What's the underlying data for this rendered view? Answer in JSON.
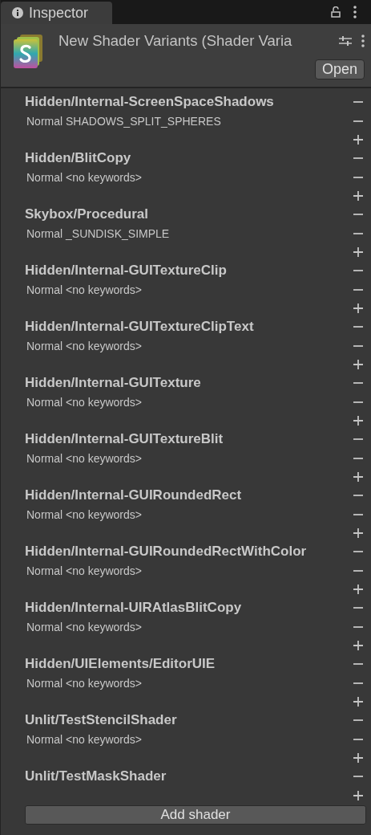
{
  "tab": {
    "label": "Inspector",
    "selected": true
  },
  "asset": {
    "title": "New Shader Variants (Shader Varia",
    "open_button": "Open"
  },
  "shaders": [
    {
      "name": "Hidden/Internal-ScreenSpaceShadows",
      "variants": [
        "Normal SHADOWS_SPLIT_SPHERES"
      ]
    },
    {
      "name": "Hidden/BlitCopy",
      "variants": [
        "Normal <no keywords>"
      ]
    },
    {
      "name": "Skybox/Procedural",
      "variants": [
        "Normal _SUNDISK_SIMPLE"
      ]
    },
    {
      "name": "Hidden/Internal-GUITextureClip",
      "variants": [
        "Normal <no keywords>"
      ]
    },
    {
      "name": "Hidden/Internal-GUITextureClipText",
      "variants": [
        "Normal <no keywords>"
      ]
    },
    {
      "name": "Hidden/Internal-GUITexture",
      "variants": [
        "Normal <no keywords>"
      ]
    },
    {
      "name": "Hidden/Internal-GUITextureBlit",
      "variants": [
        "Normal <no keywords>"
      ]
    },
    {
      "name": "Hidden/Internal-GUIRoundedRect",
      "variants": [
        "Normal <no keywords>"
      ]
    },
    {
      "name": "Hidden/Internal-GUIRoundedRectWithColor",
      "variants": [
        "Normal <no keywords>"
      ]
    },
    {
      "name": "Hidden/Internal-UIRAtlasBlitCopy",
      "variants": [
        "Normal <no keywords>"
      ]
    },
    {
      "name": "Hidden/UIElements/EditorUIE",
      "variants": [
        "Normal <no keywords>"
      ]
    },
    {
      "name": "Unlit/TestStencilShader",
      "variants": [
        "Normal <no keywords>"
      ]
    },
    {
      "name": "Unlit/TestMaskShader"
    }
  ],
  "add_button": "Add shader"
}
